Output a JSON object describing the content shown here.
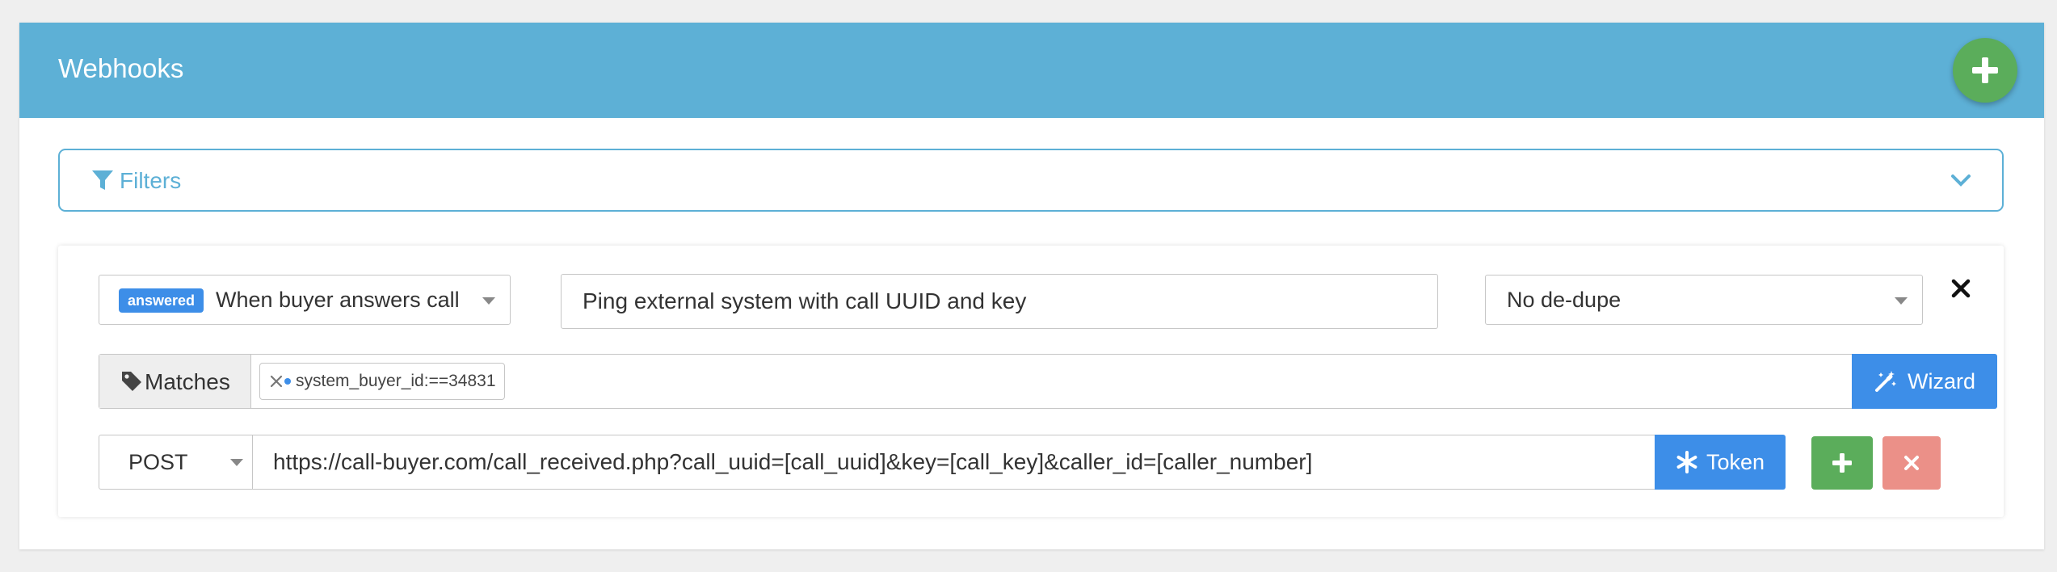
{
  "header": {
    "title": "Webhooks",
    "add_icon": "plus-icon"
  },
  "filters": {
    "icon": "filter-icon",
    "label": "Filters",
    "toggle_icon": "chevron-down-icon"
  },
  "webhook": {
    "event": {
      "badge": "answered",
      "label": "When buyer answers call"
    },
    "description": "Ping external system with call UUID and key",
    "dedupe": "No de-dupe",
    "remove_icon": "close-icon",
    "matches": {
      "label": "Matches",
      "icon": "tag-icon",
      "tags": [
        "system_buyer_id:==34831"
      ],
      "wizard_label": "Wizard",
      "wizard_icon": "magic-wand-icon"
    },
    "request": {
      "method": "POST",
      "url": "https://call-buyer.com/call_received.php?call_uuid=[call_uuid]&key=[call_key]&caller_id=[caller_number]",
      "token_label": "Token",
      "token_icon": "asterisk-icon",
      "add_icon": "plus-icon",
      "delete_icon": "close-icon"
    }
  },
  "colors": {
    "header": "#5db0d6",
    "primary": "#3d8ee8",
    "success": "#5bad5b",
    "danger": "#eb9088"
  }
}
